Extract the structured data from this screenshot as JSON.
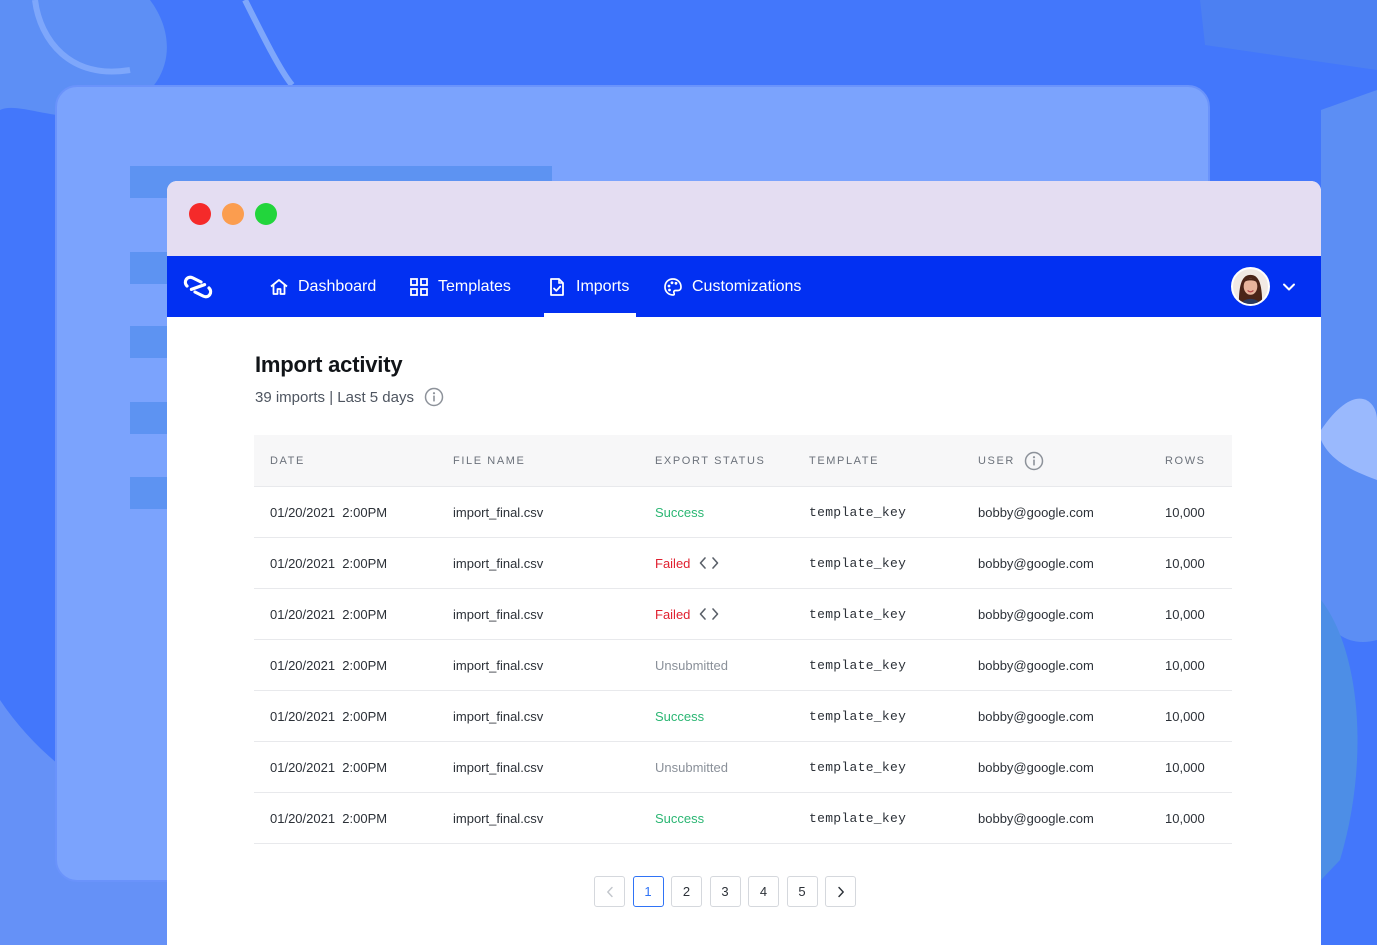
{
  "colors": {
    "background": "#4377fb",
    "nav_bar": "#0230f2",
    "title_bar": "#e4ddf2",
    "status_success": "#2bb673",
    "status_failed": "#e0202f",
    "status_unsubmitted": "#8a9099",
    "pagination_active": "#2f73f6"
  },
  "window": {
    "traffic_lights": [
      {
        "name": "close",
        "color": "#f52a2a"
      },
      {
        "name": "minimize",
        "color": "#fb9d4f"
      },
      {
        "name": "maximize",
        "color": "#22d53c"
      }
    ]
  },
  "nav": {
    "logo_icon": "link-logo-icon",
    "items": [
      {
        "label": "Dashboard",
        "icon": "home-icon",
        "active": false
      },
      {
        "label": "Templates",
        "icon": "grid-icon",
        "active": false
      },
      {
        "label": "Imports",
        "icon": "document-check-icon",
        "active": true
      },
      {
        "label": "Customizations",
        "icon": "palette-icon",
        "active": false
      }
    ],
    "user_menu_icon": "chevron-down-icon"
  },
  "page": {
    "title": "Import activity",
    "subtitle": "39 imports | Last 5 days",
    "info_icon": "info-icon"
  },
  "table": {
    "columns": [
      "Date",
      "File name",
      "Export status",
      "Template",
      "User",
      "Rows"
    ],
    "rows": [
      {
        "date": "01/20/2021  2:00PM",
        "file": "import_final.csv",
        "status": "Success",
        "status_type": "success",
        "template": "template_key",
        "user": "bobby@google.com",
        "rows": "10,000"
      },
      {
        "date": "01/20/2021  2:00PM",
        "file": "import_final.csv",
        "status": "Failed",
        "status_type": "failed",
        "template": "template_key",
        "user": "bobby@google.com",
        "rows": "10,000"
      },
      {
        "date": "01/20/2021  2:00PM",
        "file": "import_final.csv",
        "status": "Failed",
        "status_type": "failed",
        "template": "template_key",
        "user": "bobby@google.com",
        "rows": "10,000"
      },
      {
        "date": "01/20/2021  2:00PM",
        "file": "import_final.csv",
        "status": "Unsubmitted",
        "status_type": "unsubmitted",
        "template": "template_key",
        "user": "bobby@google.com",
        "rows": "10,000"
      },
      {
        "date": "01/20/2021  2:00PM",
        "file": "import_final.csv",
        "status": "Success",
        "status_type": "success",
        "template": "template_key",
        "user": "bobby@google.com",
        "rows": "10,000"
      },
      {
        "date": "01/20/2021  2:00PM",
        "file": "import_final.csv",
        "status": "Unsubmitted",
        "status_type": "unsubmitted",
        "template": "template_key",
        "user": "bobby@google.com",
        "rows": "10,000"
      },
      {
        "date": "01/20/2021  2:00PM",
        "file": "import_final.csv",
        "status": "Success",
        "status_type": "success",
        "template": "template_key",
        "user": "bobby@google.com",
        "rows": "10,000"
      }
    ]
  },
  "pagination": {
    "pages": [
      "1",
      "2",
      "3",
      "4",
      "5"
    ],
    "current": "1",
    "prev_icon": "chevron-left-icon",
    "next_icon": "chevron-right-icon"
  }
}
